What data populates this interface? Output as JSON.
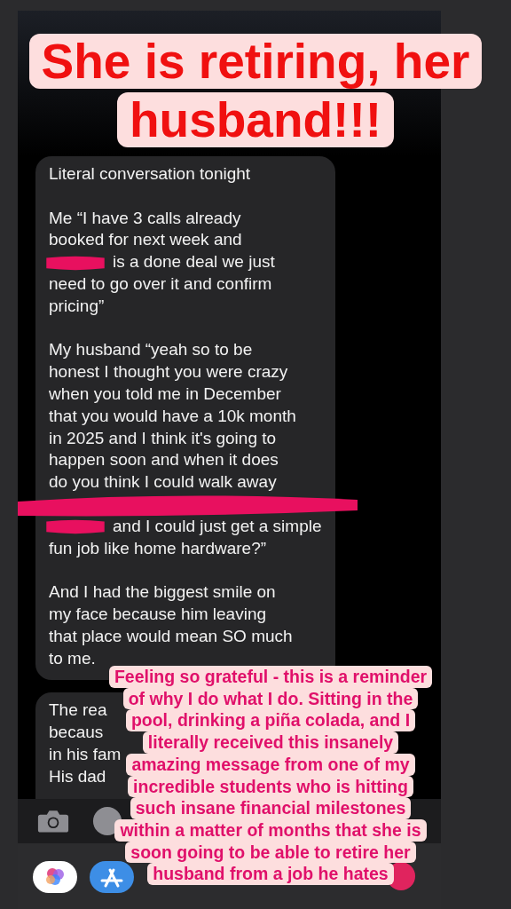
{
  "title_overlay": {
    "lines": [
      "She is retiring, her",
      "husband!!!"
    ]
  },
  "messages": [
    {
      "paragraphs": [
        [
          {
            "text": "Literal conversation tonight"
          }
        ],
        [
          {
            "text": "Me “I have 3 calls already"
          },
          {
            "text": "booked for next week and"
          },
          {
            "text": "is a done deal we just",
            "redacted_before": true
          },
          {
            "text": "need to go over it and confirm"
          },
          {
            "text": "pricing”"
          }
        ],
        [
          {
            "text": "My husband “yeah so to be"
          },
          {
            "text": "honest I thought you were crazy"
          },
          {
            "text": "when you told me in December"
          },
          {
            "text": "that you would have a 10k month"
          },
          {
            "text": "in 2025 and I think it's going to"
          },
          {
            "text": "happen soon and when it does"
          },
          {
            "text": "do you think I could walk away"
          },
          {
            "kind": "redacted"
          },
          {
            "text": "and I could just get a simple",
            "redacted_before": true
          },
          {
            "text": "fun job like home hardware?”"
          }
        ],
        [
          {
            "text": "And I had the biggest smile on"
          },
          {
            "text": "my face because him leaving"
          },
          {
            "text": "that place would mean SO much"
          },
          {
            "text": "to me."
          }
        ]
      ]
    },
    {
      "paragraphs": [
        [
          {
            "text": "The rea"
          },
          {
            "text": "becaus"
          },
          {
            "text": "in his fam"
          },
          {
            "text": "His dad"
          }
        ]
      ]
    }
  ],
  "caption_overlay": {
    "lines": [
      "Feeling so grateful - this is a reminder",
      "of why I do what I do. Sitting in the",
      "pool, drinking a piña colada, and I",
      "literally received this insanely",
      "amazing message from one of my",
      "incredible students who is hitting",
      "such insane financial milestones",
      "within a matter of months that she is",
      "soon going to be able to retire her",
      "husband from a job he hates"
    ]
  }
}
